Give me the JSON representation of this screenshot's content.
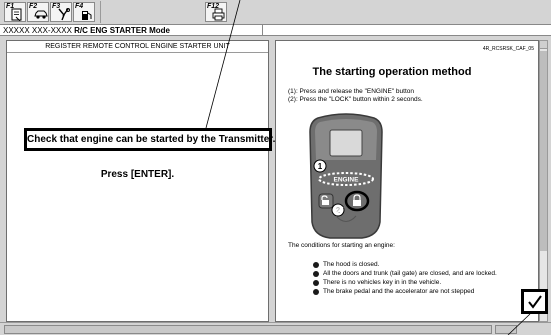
{
  "toolbar": {
    "keys": [
      {
        "label": "F1",
        "icon": "document-icon"
      },
      {
        "label": "F2",
        "icon": "car-icon"
      },
      {
        "label": "F3",
        "icon": "tools-icon"
      },
      {
        "label": "F4",
        "icon": "fuel-pump-icon"
      },
      {
        "label": "F12",
        "icon": "print-icon"
      }
    ]
  },
  "mode_bar": {
    "vehicle": "XXXXX XXX-XXXX",
    "mode": "R/C ENG STARTER Mode"
  },
  "left_panel": {
    "title": "REGISTER REMOTE CONTROL ENGINE STARTER UNIT",
    "instruction": "Check that engine can be started by the Transmitter.",
    "prompt": "Press [ENTER]."
  },
  "right_panel": {
    "doc_code": "4R_RCSRSK_CAF_05",
    "title": "The starting operation method",
    "steps": [
      "(1): Press and release the \"ENGINE\" button",
      "(2): Press the \"LOCK\" button within 2 seconds."
    ],
    "fob": {
      "marker_1": "1",
      "marker_2": "2",
      "engine_label": "ENGINE"
    },
    "conditions_intro": "The conditions for starting an engine:",
    "conditions": [
      "The hood is closed.",
      "All the doors and trunk (tail gate) are closed, and are locked.",
      "There is no vehicles key in in the vehicle.",
      "The brake pedal and the accelerator are not stepped"
    ]
  },
  "confirm": {
    "icon": "checkmark-icon"
  }
}
